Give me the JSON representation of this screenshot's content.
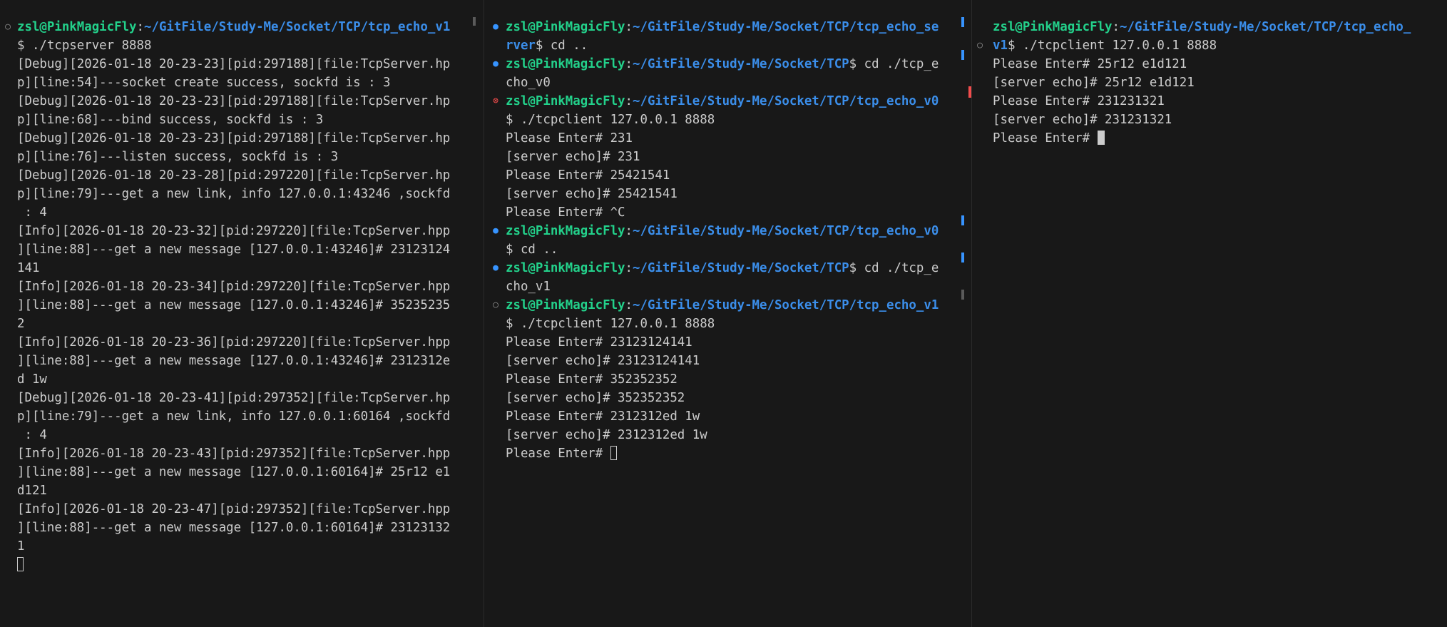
{
  "colors": {
    "background": "#181818",
    "text": "#cccccc",
    "user_host": "#23d18b",
    "path": "#3b8eea",
    "decoration_success": "#3794ff",
    "decoration_error": "#f14c4c",
    "decoration_default": "#8a8a8a"
  },
  "panes": [
    {
      "lines": [
        {
          "mark": "default",
          "user": "zsl@PinkMagicFly",
          "sep": ":",
          "path": "~/GitFile/Study-Me/Socket/TCP/tcp_echo_v1"
        },
        {
          "text": "$ ./tcpserver 8888"
        },
        {
          "text": "[Debug][2026-01-18 20-23-23][pid:297188][file:TcpServer.hp"
        },
        {
          "text": "p][line:54]---socket create success, sockfd is : 3"
        },
        {
          "text": "[Debug][2026-01-18 20-23-23][pid:297188][file:TcpServer.hp"
        },
        {
          "text": "p][line:68]---bind success, sockfd is : 3"
        },
        {
          "text": "[Debug][2026-01-18 20-23-23][pid:297188][file:TcpServer.hp"
        },
        {
          "text": "p][line:76]---listen success, sockfd is : 3"
        },
        {
          "text": "[Debug][2026-01-18 20-23-28][pid:297220][file:TcpServer.hp"
        },
        {
          "text": "p][line:79]---get a new link, info 127.0.0.1:43246 ,sockfd"
        },
        {
          "text": " : 4"
        },
        {
          "text": "[Info][2026-01-18 20-23-32][pid:297220][file:TcpServer.hpp"
        },
        {
          "text": "][line:88]---get a new message [127.0.0.1:43246]# 23123124"
        },
        {
          "text": "141"
        },
        {
          "text": "[Info][2026-01-18 20-23-34][pid:297220][file:TcpServer.hpp"
        },
        {
          "text": "][line:88]---get a new message [127.0.0.1:43246]# 35235235"
        },
        {
          "text": "2"
        },
        {
          "text": "[Info][2026-01-18 20-23-36][pid:297220][file:TcpServer.hpp"
        },
        {
          "text": "][line:88]---get a new message [127.0.0.1:43246]# 2312312e"
        },
        {
          "text": "d 1w"
        },
        {
          "text": "[Debug][2026-01-18 20-23-41][pid:297352][file:TcpServer.hp"
        },
        {
          "text": "p][line:79]---get a new link, info 127.0.0.1:60164 ,sockfd"
        },
        {
          "text": " : 4"
        },
        {
          "text": "[Info][2026-01-18 20-23-43][pid:297352][file:TcpServer.hpp"
        },
        {
          "text": "][line:88]---get a new message [127.0.0.1:60164]# 25r12 e1"
        },
        {
          "text": "d121"
        },
        {
          "text": "[Info][2026-01-18 20-23-47][pid:297352][file:TcpServer.hpp"
        },
        {
          "text": "][line:88]---get a new message [127.0.0.1:60164]# 23123132"
        },
        {
          "text": "1"
        },
        {
          "text": "",
          "cursor": "outline"
        }
      ]
    },
    {
      "lines": [
        {
          "mark": "success",
          "user": "zsl@PinkMagicFly",
          "sep": ":",
          "path": "~/GitFile/Study-Me/Socket/TCP/tcp_echo_se"
        },
        {
          "path": "rver",
          "text": "$ cd .."
        },
        {
          "mark": "success",
          "user": "zsl@PinkMagicFly",
          "sep": ":",
          "path": "~/GitFile/Study-Me/Socket/TCP",
          "text": "$ cd ./tcp_e"
        },
        {
          "text": "cho_v0"
        },
        {
          "mark": "error",
          "user": "zsl@PinkMagicFly",
          "sep": ":",
          "path": "~/GitFile/Study-Me/Socket/TCP/tcp_echo_v0"
        },
        {
          "text": "$ ./tcpclient 127.0.0.1 8888"
        },
        {
          "text": "Please Enter# 231"
        },
        {
          "text": "[server echo]# 231"
        },
        {
          "text": "Please Enter# 25421541"
        },
        {
          "text": "[server echo]# 25421541"
        },
        {
          "text": "Please Enter# ^C"
        },
        {
          "mark": "success",
          "user": "zsl@PinkMagicFly",
          "sep": ":",
          "path": "~/GitFile/Study-Me/Socket/TCP/tcp_echo_v0"
        },
        {
          "text": "$ cd .."
        },
        {
          "mark": "success",
          "user": "zsl@PinkMagicFly",
          "sep": ":",
          "path": "~/GitFile/Study-Me/Socket/TCP",
          "text": "$ cd ./tcp_e"
        },
        {
          "text": "cho_v1"
        },
        {
          "mark": "default",
          "user": "zsl@PinkMagicFly",
          "sep": ":",
          "path": "~/GitFile/Study-Me/Socket/TCP/tcp_echo_v1"
        },
        {
          "text": "$ ./tcpclient 127.0.0.1 8888"
        },
        {
          "text": "Please Enter# 23123124141"
        },
        {
          "text": "[server echo]# 23123124141"
        },
        {
          "text": "Please Enter# 352352352"
        },
        {
          "text": "[server echo]# 352352352"
        },
        {
          "text": "Please Enter# 2312312ed 1w"
        },
        {
          "text": "[server echo]# 2312312ed 1w"
        },
        {
          "text": "Please Enter# ",
          "cursor": "outline"
        }
      ]
    },
    {
      "lines": [
        {
          "user": "zsl@PinkMagicFly",
          "sep": ":",
          "path": "~/GitFile/Study-Me/Socket/TCP/tcp_echo_"
        },
        {
          "mark": "default",
          "path": "v1",
          "text": "$ ./tcpclient 127.0.0.1 8888"
        },
        {
          "text": "Please Enter# 25r12 e1d121"
        },
        {
          "text": "[server echo]# 25r12 e1d121"
        },
        {
          "text": "Please Enter# 231231321"
        },
        {
          "text": "[server echo]# 231231321"
        },
        {
          "text": "Please Enter# ",
          "cursor": "solid"
        }
      ]
    }
  ]
}
